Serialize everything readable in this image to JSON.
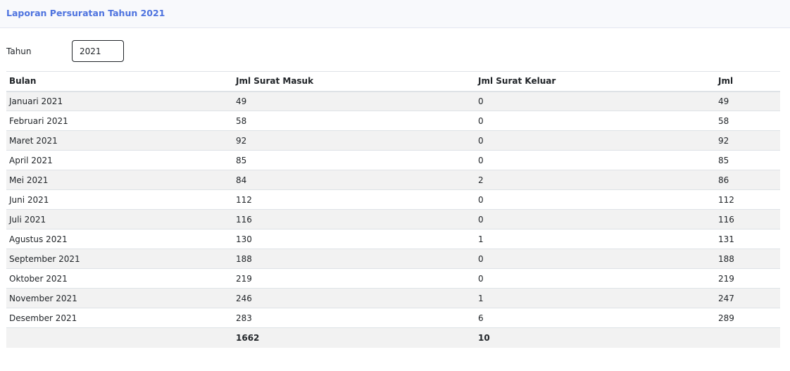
{
  "header": {
    "title": "Laporan Persuratan Tahun 2021"
  },
  "filter": {
    "label": "Tahun",
    "year_value": "2021"
  },
  "table": {
    "columns": [
      "Bulan",
      "Jml Surat Masuk",
      "Jml Surat Keluar",
      "Jml"
    ],
    "rows": [
      {
        "bulan": "Januari 2021",
        "masuk": "49",
        "keluar": "0",
        "jml": "49"
      },
      {
        "bulan": "Februari 2021",
        "masuk": "58",
        "keluar": "0",
        "jml": "58"
      },
      {
        "bulan": "Maret 2021",
        "masuk": "92",
        "keluar": "0",
        "jml": "92"
      },
      {
        "bulan": "April 2021",
        "masuk": "85",
        "keluar": "0",
        "jml": "85"
      },
      {
        "bulan": "Mei 2021",
        "masuk": "84",
        "keluar": "2",
        "jml": "86"
      },
      {
        "bulan": "Juni 2021",
        "masuk": "112",
        "keluar": "0",
        "jml": "112"
      },
      {
        "bulan": "Juli 2021",
        "masuk": "116",
        "keluar": "0",
        "jml": "116"
      },
      {
        "bulan": "Agustus 2021",
        "masuk": "130",
        "keluar": "1",
        "jml": "131"
      },
      {
        "bulan": "September 2021",
        "masuk": "188",
        "keluar": "0",
        "jml": "188"
      },
      {
        "bulan": "Oktober 2021",
        "masuk": "219",
        "keluar": "0",
        "jml": "219"
      },
      {
        "bulan": "November 2021",
        "masuk": "246",
        "keluar": "1",
        "jml": "247"
      },
      {
        "bulan": "Desember 2021",
        "masuk": "283",
        "keluar": "6",
        "jml": "289"
      }
    ],
    "totals": {
      "bulan": "",
      "masuk": "1662",
      "keluar": "10",
      "jml": ""
    }
  }
}
